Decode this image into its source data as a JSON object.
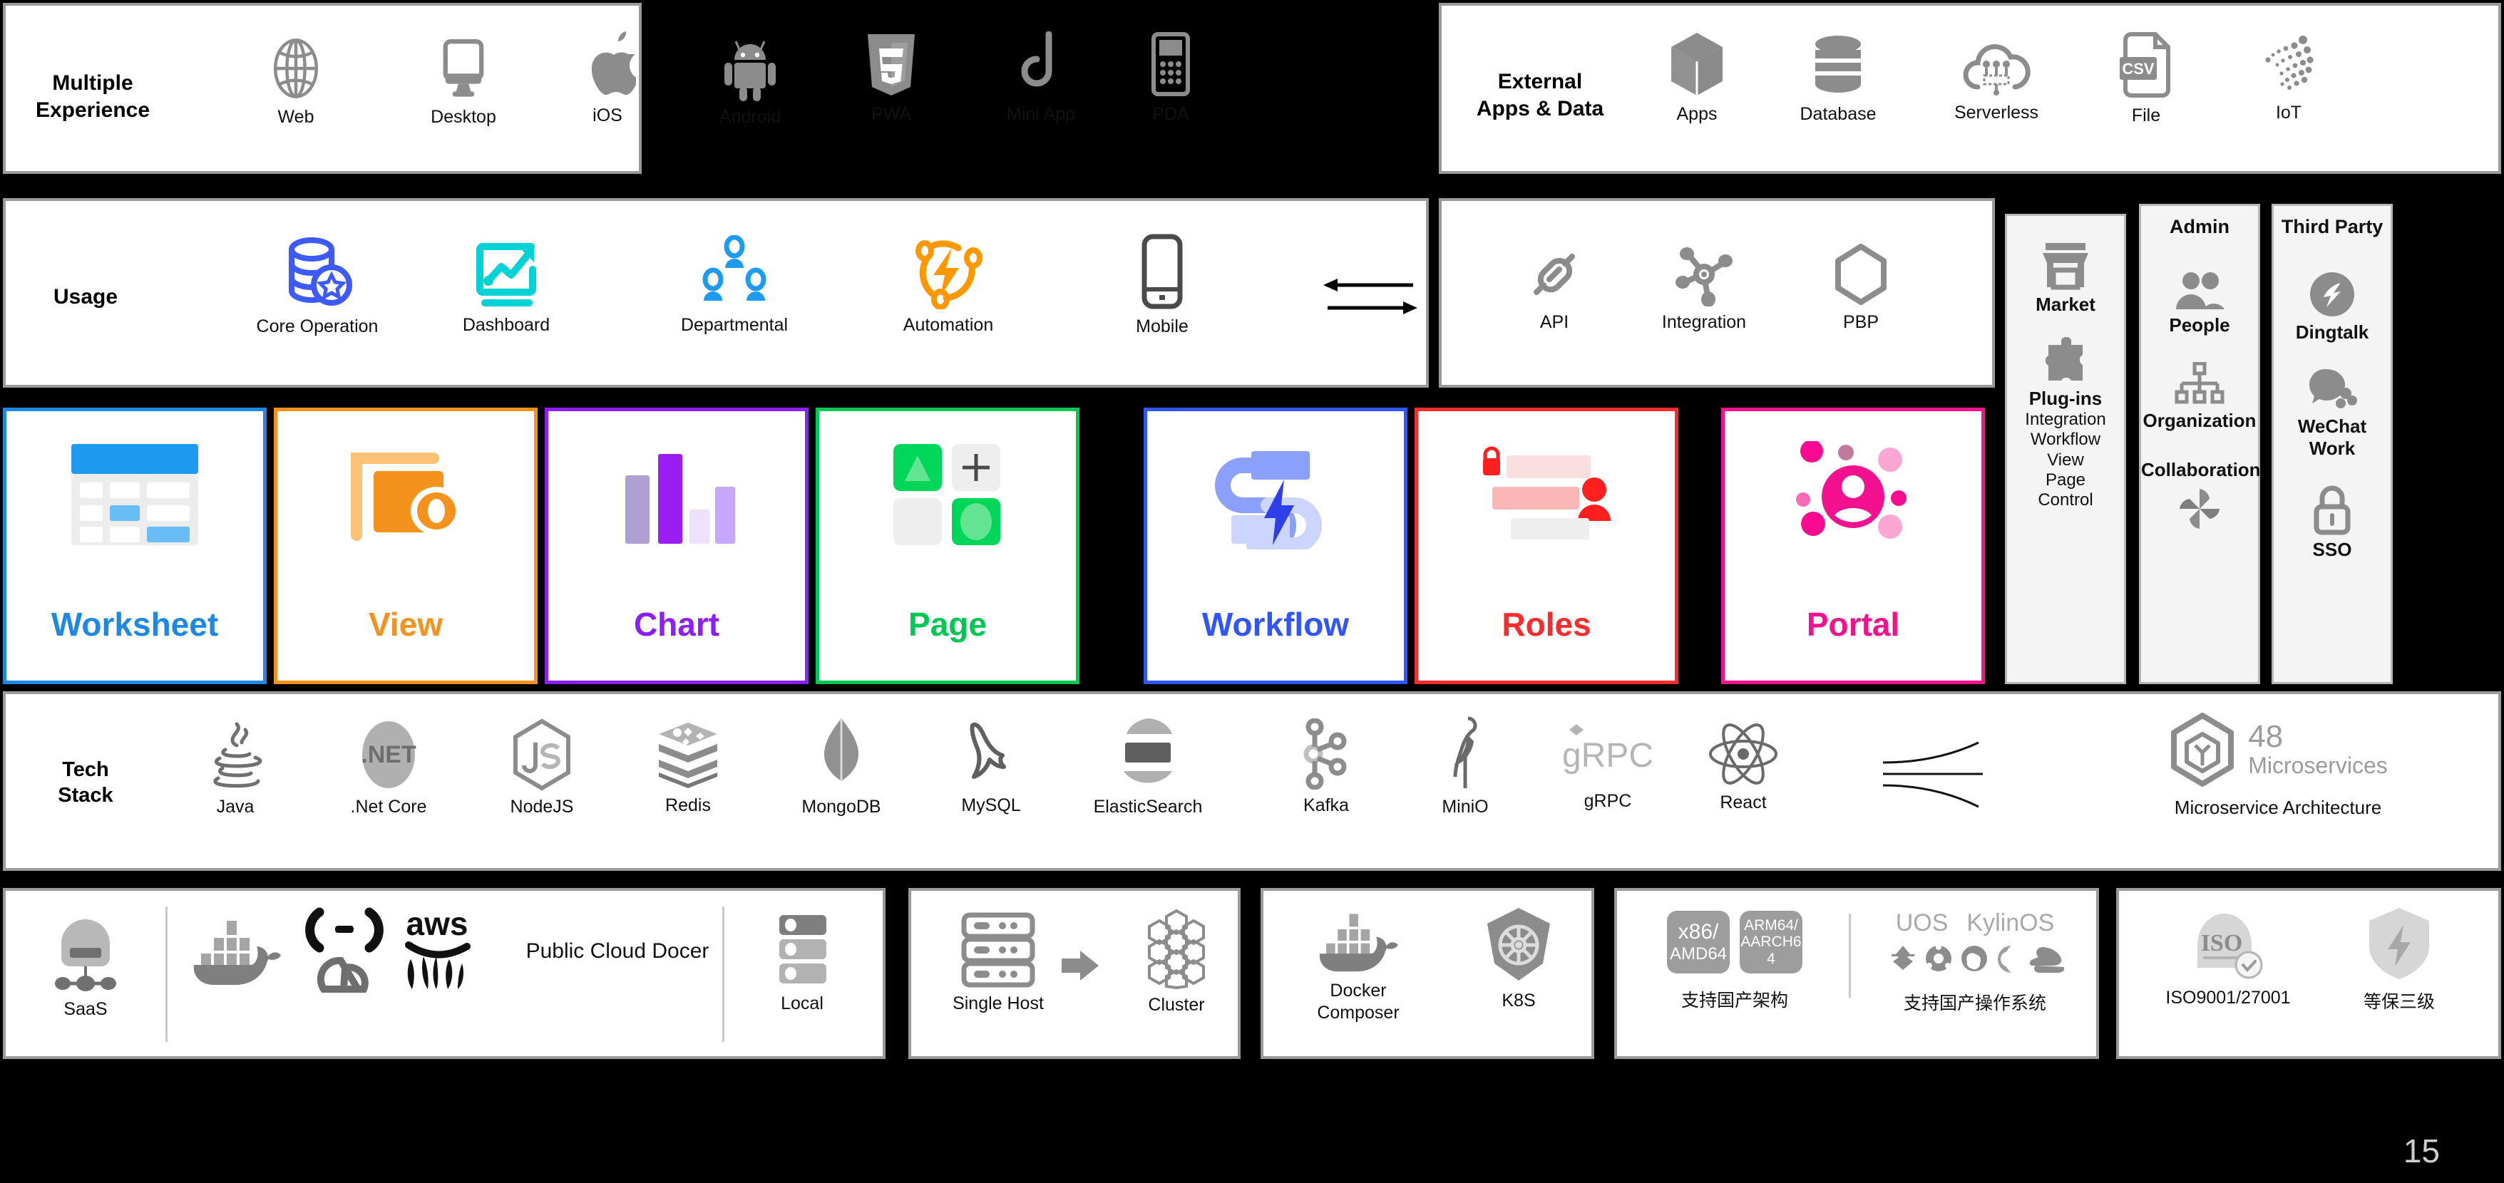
{
  "page_number": "15",
  "rows": {
    "multiple_experience": {
      "label": "Multiple\nExperience",
      "label_line1": "Multiple",
      "label_line2": "Experience",
      "items": [
        {
          "label": "Web",
          "icon": "globe-icon"
        },
        {
          "label": "Desktop",
          "icon": "desktop-monitor-icon"
        },
        {
          "label": "iOS",
          "icon": "apple-logo-icon"
        },
        {
          "label": "Android",
          "icon": "android-robot-icon"
        },
        {
          "label": "PWA",
          "icon": "html5-shield-icon"
        },
        {
          "label": "Mini App",
          "icon": "mini-app-hook-icon"
        },
        {
          "label": "PDA",
          "icon": "pda-device-icon"
        }
      ]
    },
    "external_apps_data": {
      "label_line1": "External",
      "label_line2": "Apps & Data",
      "items": [
        {
          "label": "Apps",
          "icon": "cube-icon"
        },
        {
          "label": "Database",
          "icon": "database-cylinder-icon"
        },
        {
          "label": "Serverless",
          "icon": "cloud-circuit-icon"
        },
        {
          "label": "File",
          "icon": "csv-file-icon"
        },
        {
          "label": "IoT",
          "icon": "iota-dots-icon"
        }
      ]
    },
    "usage": {
      "label": "Usage",
      "items": [
        {
          "label": "Core Operation",
          "icon": "database-star-icon",
          "color": "#3d5afe"
        },
        {
          "label": "Dashboard",
          "icon": "chart-trend-icon",
          "color": "#00d2d6"
        },
        {
          "label": "Departmental",
          "icon": "org-people-icon",
          "color": "#1e9bf0"
        },
        {
          "label": "Automation",
          "icon": "automation-bolt-icon",
          "color": "#ff9800"
        },
        {
          "label": "Mobile",
          "icon": "mobile-phone-icon",
          "color": "#4a4a4a"
        }
      ]
    },
    "interfaces": {
      "items": [
        {
          "label": "API",
          "icon": "api-plug-icon"
        },
        {
          "label": "Integration",
          "icon": "integration-node-icon"
        },
        {
          "label": "PBP",
          "icon": "hexagon-icon"
        }
      ]
    },
    "modules": [
      {
        "label": "Worksheet",
        "icon": "worksheet-table-icon",
        "color": "#1e88e5"
      },
      {
        "label": "View",
        "icon": "view-layers-eye-icon",
        "color": "#f5921e"
      },
      {
        "label": "Chart",
        "icon": "chart-bars-icon",
        "color": "#8c1eff"
      },
      {
        "label": "Page",
        "icon": "page-grid-icon",
        "color": "#00c853"
      },
      {
        "label": "Workflow",
        "icon": "workflow-bolt-icon",
        "color": "#2f55ff"
      },
      {
        "label": "Roles",
        "icon": "roles-lock-icon",
        "color": "#ff2b2b"
      },
      {
        "label": "Portal",
        "icon": "portal-user-icon",
        "color": "#f4118f"
      }
    ],
    "market_column": {
      "items": [
        {
          "label": "Market",
          "icon": "storefront-icon"
        },
        {
          "label": "Plug-ins",
          "icon": "puzzle-piece-icon"
        }
      ],
      "plugin_sub": [
        "Integration",
        "Workflow",
        "View",
        "Page",
        "Control"
      ]
    },
    "admin_column": {
      "title": "Admin",
      "items": [
        {
          "label": "People",
          "icon": "people-icon"
        },
        {
          "label": "Organization",
          "icon": "org-chart-icon"
        },
        {
          "label": "Collaboration",
          "icon": "pinwheel-icon"
        }
      ]
    },
    "third_party_column": {
      "title": "Third Party",
      "items": [
        {
          "label": "Dingtalk",
          "icon": "dingtalk-icon"
        },
        {
          "label": "WeChat Work",
          "icon": "wechat-work-icon"
        },
        {
          "label": "SSO",
          "icon": "padlock-icon"
        }
      ]
    },
    "tech_stack": {
      "label_line1": "Tech",
      "label_line2": "Stack",
      "items": [
        {
          "label": "Java",
          "icon": "java-coffee-icon"
        },
        {
          "label": ".Net Core",
          "icon": "dotnet-icon"
        },
        {
          "label": "NodeJS",
          "icon": "nodejs-hexagon-icon"
        },
        {
          "label": "Redis",
          "icon": "redis-stack-icon"
        },
        {
          "label": "MongoDB",
          "icon": "mongodb-leaf-icon"
        },
        {
          "label": "MySQL",
          "icon": "mysql-dolphin-icon"
        },
        {
          "label": "ElasticSearch",
          "icon": "elasticsearch-icon"
        },
        {
          "label": "Kafka",
          "icon": "kafka-nodes-icon"
        },
        {
          "label": "MiniO",
          "icon": "minio-flamingo-icon"
        },
        {
          "label": "gRPC",
          "icon": "grpc-icon"
        },
        {
          "label": "React",
          "icon": "react-atom-icon"
        },
        {
          "label": "",
          "icon": "nginx-curves-icon"
        }
      ],
      "microservice": {
        "count": "48",
        "count_label": "Microservices",
        "label": "Microservice Architecture",
        "icon": "microservice-hexagon-icon"
      }
    },
    "deployment": {
      "groups": [
        {
          "name": "saas-cloud-local-group",
          "items": [
            {
              "label": "SaaS",
              "icon": "saas-cloud-icon"
            },
            {
              "label": "Public Cloud Docer",
              "icon": "public-cloud-logos-icon",
              "logos": [
                "docker-whale-icon",
                "alibaba-cloud-icon",
                "aws-icon",
                "tencent-cloud-icon",
                "huawei-icon"
              ]
            },
            {
              "label": "Local",
              "icon": "local-server-icon"
            }
          ]
        },
        {
          "name": "host-cluster-group",
          "items": [
            {
              "label": "Single Host",
              "icon": "server-rack-icon"
            },
            {
              "label": "Cluster",
              "icon": "cluster-hex-icon"
            }
          ],
          "arrow": "arrow-right-icon"
        },
        {
          "name": "container-group",
          "items": [
            {
              "label": "Docker\nComposer",
              "label_line1": "Docker",
              "label_line2": "Composer",
              "icon": "docker-whale-icon"
            },
            {
              "label": "K8S",
              "icon": "kubernetes-helm-icon"
            }
          ]
        },
        {
          "name": "architecture-os-group",
          "items": [
            {
              "label": "支持国产架构",
              "icon": "cpu-arch-badges-icon",
              "badges": [
                {
                  "line1": "x86/",
                  "line2": "AMD64"
                },
                {
                  "line1": "ARM64/",
                  "line2": "AARCH6",
                  "line3": "4"
                }
              ]
            },
            {
              "label": "支持国产操作系统",
              "icon": "domestic-os-logos-icon",
              "os_names": [
                "UOS",
                "KylinOS"
              ],
              "os_logos": [
                "kylin-icon",
                "ubuntu-icon",
                "openeuler-icon",
                "debian-icon",
                "redhat-icon"
              ]
            }
          ]
        },
        {
          "name": "certification-group",
          "items": [
            {
              "label": "ISO9001/27001",
              "icon": "iso-certificate-icon"
            },
            {
              "label": "等保三级",
              "icon": "shield-bolt-icon"
            }
          ]
        }
      ]
    }
  }
}
